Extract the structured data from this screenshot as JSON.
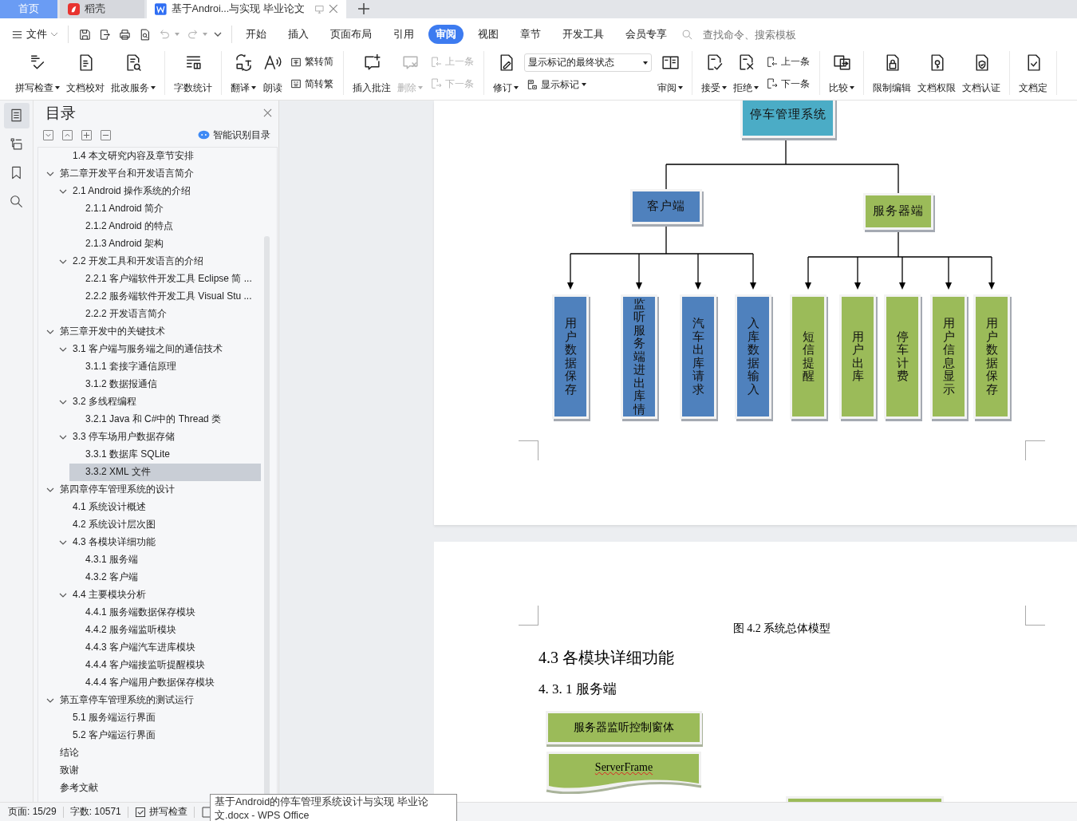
{
  "browser_tabs": [
    {
      "label": "首页",
      "kind": "home",
      "selected": false
    },
    {
      "label": "稻壳",
      "kind": "docer",
      "selected": false
    },
    {
      "label": "基于Androi...与实现 毕业论文",
      "kind": "document",
      "selected": true
    }
  ],
  "menu": {
    "file": "文件",
    "quick_access": [
      {
        "kind": "save",
        "disabled": false
      },
      {
        "kind": "export",
        "disabled": false
      },
      {
        "kind": "print",
        "disabled": false
      },
      {
        "kind": "preview",
        "disabled": false
      },
      {
        "kind": "undo",
        "disabled": true
      },
      {
        "kind": "redo",
        "disabled": true
      }
    ],
    "tabs": [
      {
        "label": "开始",
        "selected": false
      },
      {
        "label": "插入",
        "selected": false
      },
      {
        "label": "页面布局",
        "selected": false
      },
      {
        "label": "引用",
        "selected": false
      },
      {
        "label": "审阅",
        "selected": true
      },
      {
        "label": "视图",
        "selected": false
      },
      {
        "label": "章节",
        "selected": false
      },
      {
        "label": "开发工具",
        "selected": false
      },
      {
        "label": "会员专享",
        "selected": false
      }
    ],
    "search": {
      "placeholder": "查找命令、搜索模板"
    }
  },
  "ribbon": {
    "groups": [
      [
        {
          "kind": "large",
          "label": "拼写检查",
          "dropdown": true,
          "disabled": false
        },
        {
          "kind": "large",
          "label": "文档校对",
          "dropdown": false,
          "disabled": false
        },
        {
          "kind": "large",
          "label": "批改服务",
          "dropdown": true,
          "disabled": false
        }
      ],
      [
        {
          "kind": "large",
          "label": "字数统计",
          "dropdown": false,
          "disabled": false
        }
      ],
      [
        {
          "kind": "large",
          "label": "翻译",
          "dropdown": true,
          "disabled": false
        },
        {
          "kind": "large",
          "label": "朗读",
          "dropdown": false,
          "disabled": false
        },
        {
          "kind": "stack",
          "items": [
            {
              "kind": "small",
              "label": "繁转简",
              "dropdown": false,
              "disabled": false
            },
            {
              "kind": "small",
              "label": "简转繁",
              "dropdown": false,
              "disabled": false
            }
          ]
        }
      ],
      [
        {
          "kind": "large",
          "label": "插入批注",
          "dropdown": false,
          "disabled": false
        },
        {
          "kind": "large",
          "label": "删除",
          "dropdown": true,
          "disabled": true
        },
        {
          "kind": "stack",
          "items": [
            {
              "kind": "small",
              "label": "上一条",
              "dropdown": false,
              "disabled": true
            },
            {
              "kind": "small",
              "label": "下一条",
              "dropdown": false,
              "disabled": true
            }
          ]
        }
      ],
      [
        {
          "kind": "large",
          "label": "修订",
          "dropdown": true,
          "disabled": false
        },
        {
          "kind": "stack",
          "items": [
            {
              "kind": "select",
              "value": "显示标记的最终状态"
            },
            {
              "kind": "small",
              "label": "显示标记",
              "dropdown": true,
              "disabled": false
            }
          ]
        },
        {
          "kind": "large",
          "label": "审阅",
          "dropdown": true,
          "disabled": false
        }
      ],
      [
        {
          "kind": "large",
          "label": "接受",
          "dropdown": true,
          "disabled": false
        },
        {
          "kind": "large",
          "label": "拒绝",
          "dropdown": true,
          "disabled": false
        },
        {
          "kind": "stack",
          "items": [
            {
              "kind": "small",
              "label": "上一条",
              "dropdown": false,
              "disabled": false
            },
            {
              "kind": "small",
              "label": "下一条",
              "dropdown": false,
              "disabled": false
            }
          ]
        }
      ],
      [
        {
          "kind": "large",
          "label": "比较",
          "dropdown": true,
          "disabled": false
        }
      ],
      [
        {
          "kind": "large",
          "label": "限制编辑",
          "dropdown": false,
          "disabled": false
        },
        {
          "kind": "large",
          "label": "文档权限",
          "dropdown": false,
          "disabled": false
        },
        {
          "kind": "large",
          "label": "文档认证",
          "dropdown": false,
          "disabled": false
        }
      ],
      [
        {
          "kind": "large",
          "label": "文档定",
          "dropdown": false,
          "disabled": false
        }
      ]
    ]
  },
  "side_tools": [
    {
      "kind": "toc",
      "selected": true
    },
    {
      "kind": "nav",
      "selected": false
    },
    {
      "kind": "bookmark",
      "selected": false
    },
    {
      "kind": "search",
      "selected": false
    }
  ],
  "toc": {
    "title": "目录",
    "smart_button": "智能识别目录",
    "items": [
      {
        "children": [
          {
            "label": "1.4  本文研究内容及章节安排",
            "selected": false
          }
        ]
      },
      {
        "label": "第二章开发平台和开发语言简介",
        "selected": false,
        "expanded": true,
        "children": [
          {
            "label": "2.1 Android 操作系统的介绍",
            "selected": false,
            "expanded": true,
            "children": [
              {
                "label": "2.1.1 Android 简介",
                "selected": false
              },
              {
                "label": "2.1.2 Android 的特点",
                "selected": false
              },
              {
                "label": "2.1.3 Android 架构",
                "selected": false
              }
            ]
          },
          {
            "label": "2.2 开发工具和开发语言的介绍",
            "selected": false,
            "expanded": true,
            "children": [
              {
                "label": "2.2.1    客户端软件开发工具 Eclipse 简 ...",
                "selected": false
              },
              {
                "label": "2.2.2  服务端软件开发工具 Visual Stu ...",
                "selected": false
              },
              {
                "label": "2.2.2  开发语言简介",
                "selected": false
              }
            ]
          }
        ]
      },
      {
        "label": "第三章开发中的关键技术",
        "selected": false,
        "expanded": true,
        "children": [
          {
            "label": "3.1  客户端与服务端之间的通信技术",
            "selected": false,
            "expanded": true,
            "children": [
              {
                "label": "3.1.1  套接字通信原理",
                "selected": false
              },
              {
                "label": "3.1.2  数据报通信",
                "selected": false
              }
            ]
          },
          {
            "label": "3.2 多线程编程",
            "selected": false,
            "expanded": true,
            "children": [
              {
                "label": "3.2.1    Java 和 C#中的 Thread 类",
                "selected": false
              }
            ]
          },
          {
            "label": "3.3  停车场用户数据存储",
            "selected": false,
            "expanded": true,
            "children": [
              {
                "label": "3.3.1  数据库 SQLite",
                "selected": false
              },
              {
                "label": "3.3.2 XML 文件",
                "selected": true
              }
            ]
          }
        ]
      },
      {
        "label": "第四章停车管理系统的设计",
        "selected": false,
        "expanded": true,
        "children": [
          {
            "label": "4.1  系统设计概述",
            "selected": false
          },
          {
            "label": "4.2    系统设计层次图",
            "selected": false
          },
          {
            "label": "4.3  各模块详细功能",
            "selected": false,
            "expanded": true,
            "children": [
              {
                "label": "4.3.1  服务端",
                "selected": false
              },
              {
                "label": "4.3.2  客户端",
                "selected": false
              }
            ]
          },
          {
            "label": "4.4  主要模块分析",
            "selected": false,
            "expanded": true,
            "children": [
              {
                "label": "4.4.1  服务端数据保存模块",
                "selected": false
              },
              {
                "label": "4.4.2  服务端监听模块",
                "selected": false
              },
              {
                "label": "4.4.3  客户端汽车进库模块",
                "selected": false
              },
              {
                "label": "4.4.4  客户端接监听提醒模块",
                "selected": false
              },
              {
                "label": "4.4.4  客户端用户数据保存模块",
                "selected": false
              }
            ]
          }
        ]
      },
      {
        "label": "第五章停车管理系统的测试运行",
        "selected": false,
        "expanded": true,
        "children": [
          {
            "label": "5.1  服务端运行界面",
            "selected": false
          },
          {
            "label": "5.2  客户端运行界面",
            "selected": false
          }
        ]
      },
      {
        "label": "结论",
        "selected": false
      },
      {
        "label": "致谢",
        "selected": false
      },
      {
        "label": "参考文献",
        "selected": false
      }
    ]
  },
  "document": {
    "diagram": {
      "root": "停车管理系统",
      "branches": [
        {
          "label": "客户端",
          "color": "#4f81bd",
          "leaves": [
            "用户数据保存",
            "监听服务端进出库情",
            "汽车出库请求",
            "入库数据输入"
          ]
        },
        {
          "label": "服务器端",
          "color": "#9bbb59",
          "leaves": [
            "短信提醒",
            "用户出库",
            "停车计费",
            "用户信息显示",
            "用户数据保存"
          ]
        }
      ]
    },
    "caption": "图 4.2  系统总体模型",
    "heading": "4.3  各模块详细功能",
    "subheading": "4. 3. 1  服务端",
    "flow_boxes": [
      {
        "kind": "process",
        "label": "服务器监听控制窗体",
        "spelling_error": false
      },
      {
        "kind": "document",
        "label": "ServerFrame",
        "spelling_error": true
      }
    ]
  },
  "status_bar": {
    "page": "页面: 15/29",
    "words": "字数: 10571",
    "spell_check": {
      "label": "拼写检查",
      "checked": true
    }
  },
  "tooltip": "基于Android的停车管理系统设计与实现 毕业论文.docx - WPS Office"
}
